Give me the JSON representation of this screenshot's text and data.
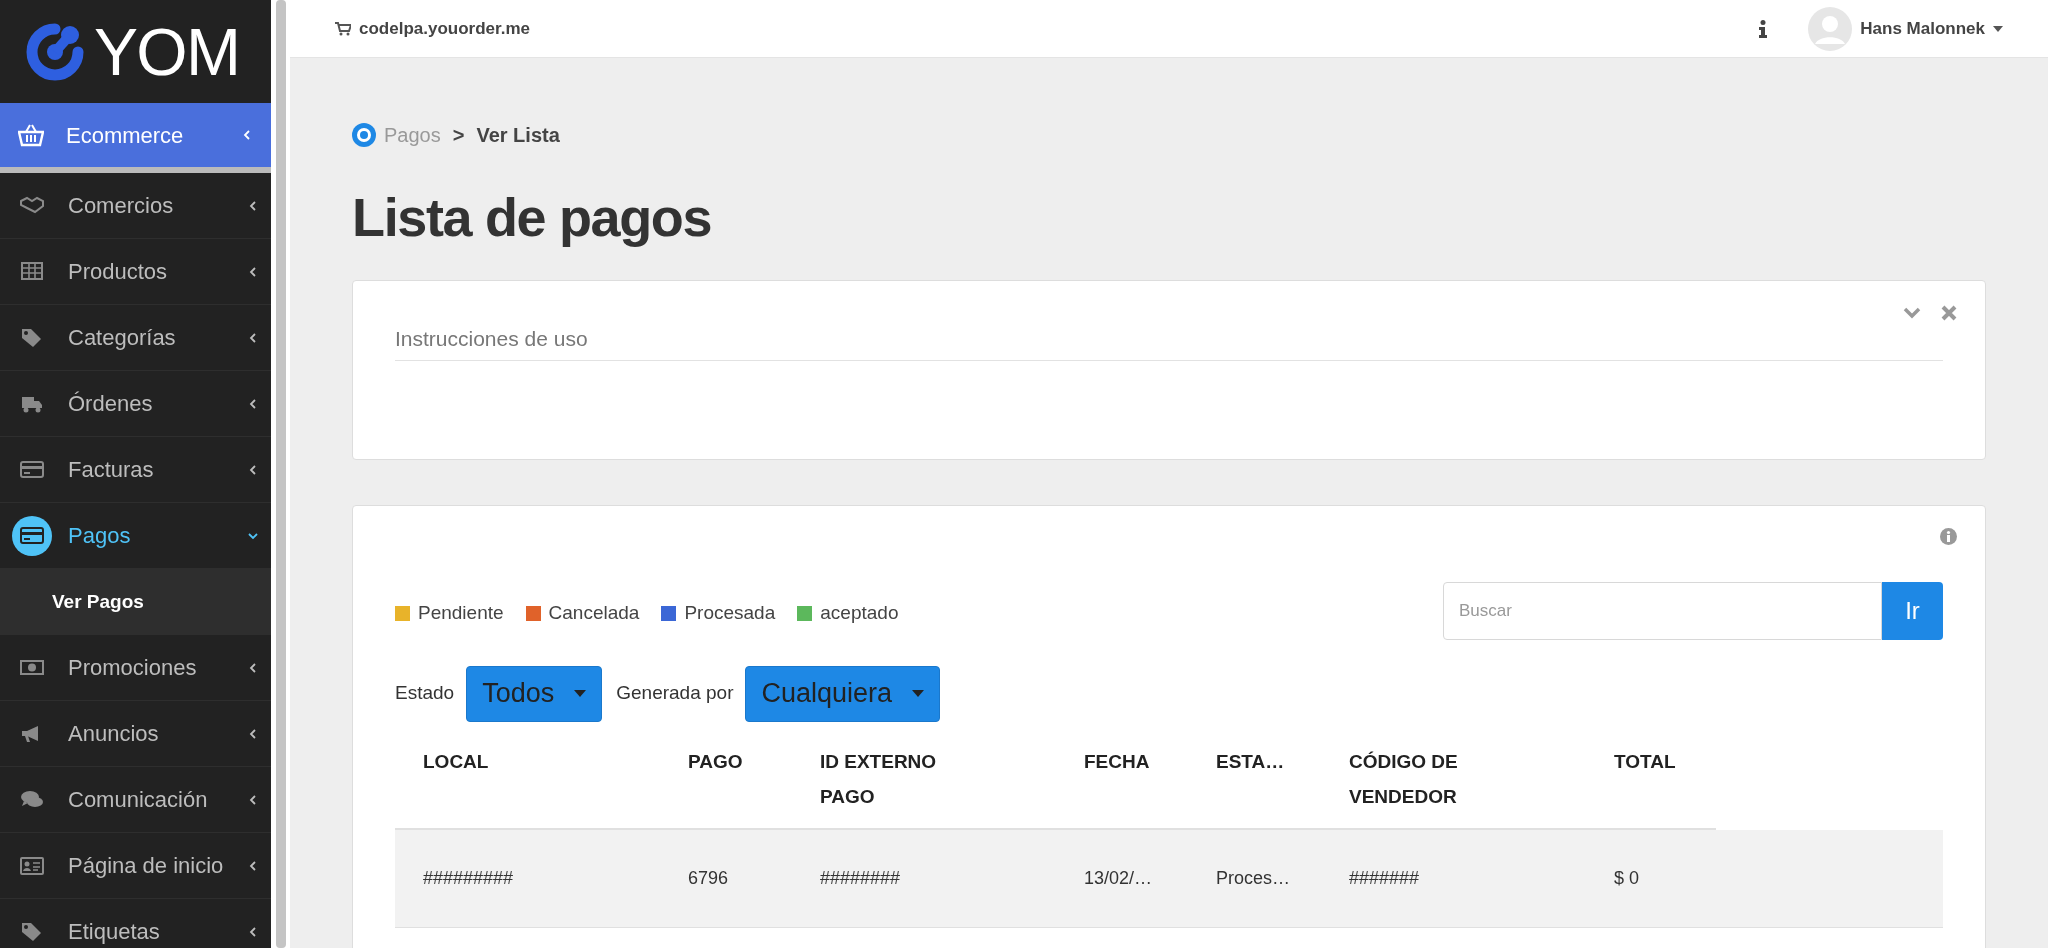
{
  "logo": {
    "text": "YOM"
  },
  "sidebar": {
    "section": {
      "label": "Ecommerce"
    },
    "items": [
      {
        "label": "Comercios",
        "selected": false,
        "expanded": false
      },
      {
        "label": "Productos",
        "selected": false,
        "expanded": false
      },
      {
        "label": "Categorías",
        "selected": false,
        "expanded": false
      },
      {
        "label": "Órdenes",
        "selected": false,
        "expanded": false
      },
      {
        "label": "Facturas",
        "selected": false,
        "expanded": false
      },
      {
        "label": "Pagos",
        "selected": true,
        "expanded": true,
        "children": [
          {
            "label": "Ver Pagos",
            "selected": true
          }
        ]
      },
      {
        "label": "Promociones",
        "selected": false,
        "expanded": false
      },
      {
        "label": "Anuncios",
        "selected": false,
        "expanded": false
      },
      {
        "label": "Comunicación",
        "selected": false,
        "expanded": false
      },
      {
        "label": "Página de inicio",
        "selected": false,
        "expanded": false
      },
      {
        "label": "Etiquetas",
        "selected": false,
        "expanded": false
      }
    ]
  },
  "topbar": {
    "store": "codelpa.youorder.me",
    "user": "Hans Malonnek"
  },
  "breadcrumb": {
    "parent": "Pagos",
    "separator": ">",
    "current": "Ver Lista"
  },
  "title": "Lista de pagos",
  "instructions_card": {
    "title": "Instrucciones de uso"
  },
  "legend": [
    {
      "label": "Pendiente",
      "color": "#e8b32a"
    },
    {
      "label": "Cancelada",
      "color": "#e0622a"
    },
    {
      "label": "Procesada",
      "color": "#3b67d6"
    },
    {
      "label": "aceptado",
      "color": "#5cb85c"
    }
  ],
  "search": {
    "placeholder": "Buscar",
    "button": "Ir"
  },
  "filters": [
    {
      "label": "Estado",
      "value": "Todos"
    },
    {
      "label": "Generada por",
      "value": "Cualquiera"
    }
  ],
  "table": {
    "columns": [
      "LOCAL",
      "PAGO",
      "ID EXTERNO PAGO",
      "FECHA",
      "ESTA…",
      "CÓDIGO DE VENDEDOR",
      "TOTAL"
    ],
    "rows": [
      [
        "#########",
        "6796",
        "########",
        "13/02/…",
        "Proces…",
        "#######",
        "$ 0"
      ]
    ]
  }
}
